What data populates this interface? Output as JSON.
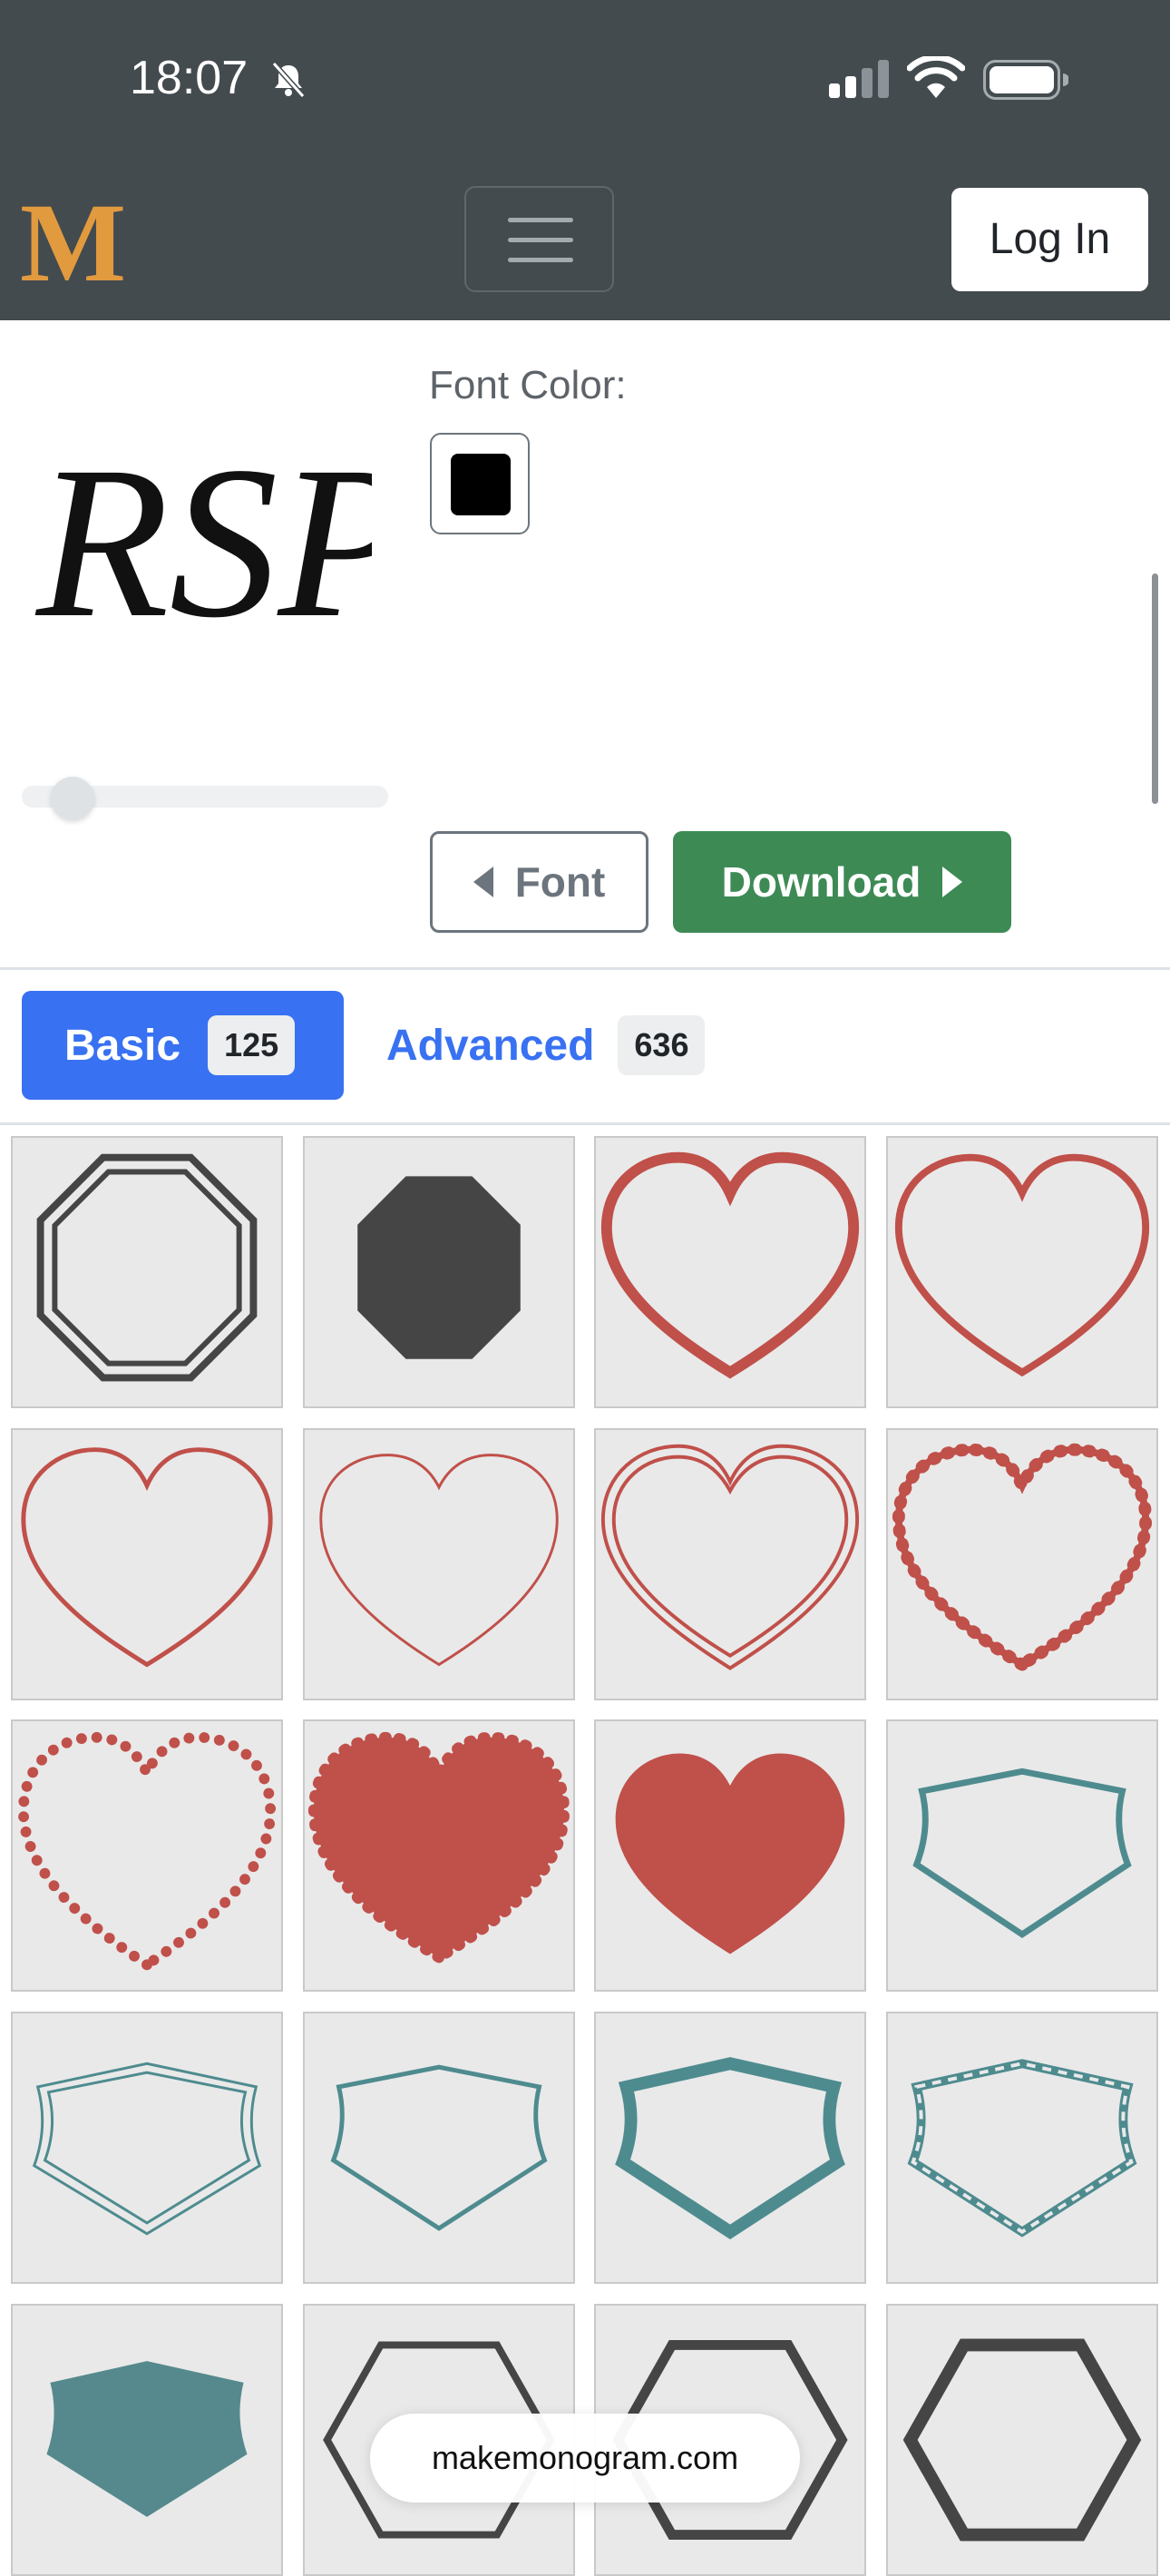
{
  "status_bar": {
    "time": "18:07"
  },
  "navbar": {
    "logo": "M",
    "login_label": "Log In"
  },
  "editor": {
    "monogram_text": "RSP",
    "font_color_label": "Font Color:",
    "font_color": "#000000",
    "font_button_label": "Font",
    "download_button_label": "Download"
  },
  "tabs": {
    "basic": {
      "label": "Basic",
      "count": "125"
    },
    "advanced": {
      "label": "Advanced",
      "count": "636"
    }
  },
  "colors": {
    "accent_blue": "#3871f2",
    "download_green": "#3d8a55",
    "heart_red": "#c0504a",
    "teal": "#4e8b8f",
    "dark": "#454545",
    "logo_orange": "#e29a3f"
  },
  "frames": [
    {
      "name": "double-octagon-outline",
      "icon": "octagon-double-icon"
    },
    {
      "name": "octagon-filled",
      "icon": "octagon-filled-icon"
    },
    {
      "name": "heart-thick-outline",
      "icon": "heart-outline-icon"
    },
    {
      "name": "heart-medium-outline",
      "icon": "heart-outline-icon"
    },
    {
      "name": "heart-outline",
      "icon": "heart-outline-icon"
    },
    {
      "name": "heart-thin-outline",
      "icon": "heart-outline-icon"
    },
    {
      "name": "heart-double-outline",
      "icon": "heart-double-icon"
    },
    {
      "name": "heart-scalloped-outline",
      "icon": "heart-scalloped-icon"
    },
    {
      "name": "heart-dotted",
      "icon": "heart-dotted-icon"
    },
    {
      "name": "heart-scalloped-filled",
      "icon": "heart-scalloped-filled-icon"
    },
    {
      "name": "heart-filled",
      "icon": "heart-filled-icon"
    },
    {
      "name": "shield-thin",
      "icon": "shield-outline-icon"
    },
    {
      "name": "shield-double",
      "icon": "shield-double-icon"
    },
    {
      "name": "shield-outline",
      "icon": "shield-outline-icon"
    },
    {
      "name": "shield-thick",
      "icon": "shield-thick-icon"
    },
    {
      "name": "shield-dashed",
      "icon": "shield-dashed-icon"
    },
    {
      "name": "shield-filled",
      "icon": "shield-filled-icon"
    },
    {
      "name": "hexagon-outline",
      "icon": "hexagon-outline-icon"
    },
    {
      "name": "hexagon-outline-medium",
      "icon": "hexagon-outline-icon"
    },
    {
      "name": "hexagon-outline-thick",
      "icon": "hexagon-outline-icon"
    }
  ],
  "browser": {
    "url": "makemonogram.com"
  }
}
